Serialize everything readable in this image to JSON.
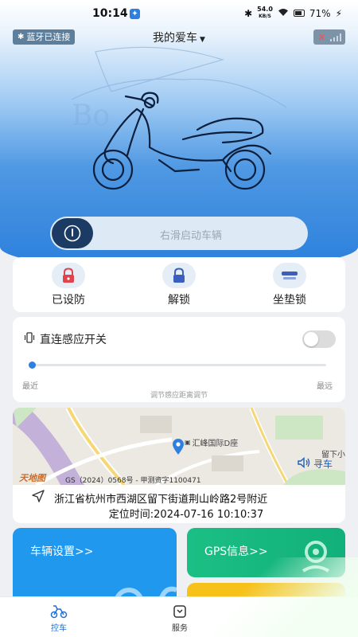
{
  "status_bar": {
    "time": "10:14",
    "network_speed_value": "54.0",
    "network_speed_unit": "KB/S",
    "battery": "71%"
  },
  "header": {
    "bluetooth_badge": "蓝牙已连接",
    "title": "我的爱车"
  },
  "hero": {
    "slider_text": "右滑启动车辆"
  },
  "locks": {
    "items": [
      {
        "label": "已设防",
        "icon": "lock-red-icon",
        "color": "#e0434b"
      },
      {
        "label": "解锁",
        "icon": "unlock-icon",
        "color": "#3b5fbf"
      },
      {
        "label": "坐垫锁",
        "icon": "seat-lock-icon",
        "color": "#3b5fbf"
      }
    ]
  },
  "proximity": {
    "title": "直连感应开关",
    "toggle_on": false,
    "range_value": 0,
    "min_label": "最近",
    "max_label": "最远",
    "caption": "调节感应距离调节"
  },
  "map": {
    "poi_label": "汇峰国际D座",
    "poi_label_2": "留下小",
    "copyright": "GS（2024）0568号 - 甲测资字1100471",
    "logo_text": "天地图",
    "find_car_label": "寻车",
    "address": "浙江省杭州市西湖区留下街道荆山岭路2号附近",
    "location_time": "定位时间:2024-07-16 10:10:37"
  },
  "tiles": {
    "settings_label": "车辆设置>>",
    "gps_label": "GPS信息>>"
  },
  "tabs": [
    {
      "label": "控车",
      "active": true
    },
    {
      "label": "服务",
      "active": false
    }
  ],
  "colors": {
    "accent": "#1e6fd6",
    "hero_blue": "#2a7fdc",
    "settings_tile": "#1f98ee",
    "gps_tile": "#1bbf84",
    "yellow_tile": "#f6c21a"
  }
}
